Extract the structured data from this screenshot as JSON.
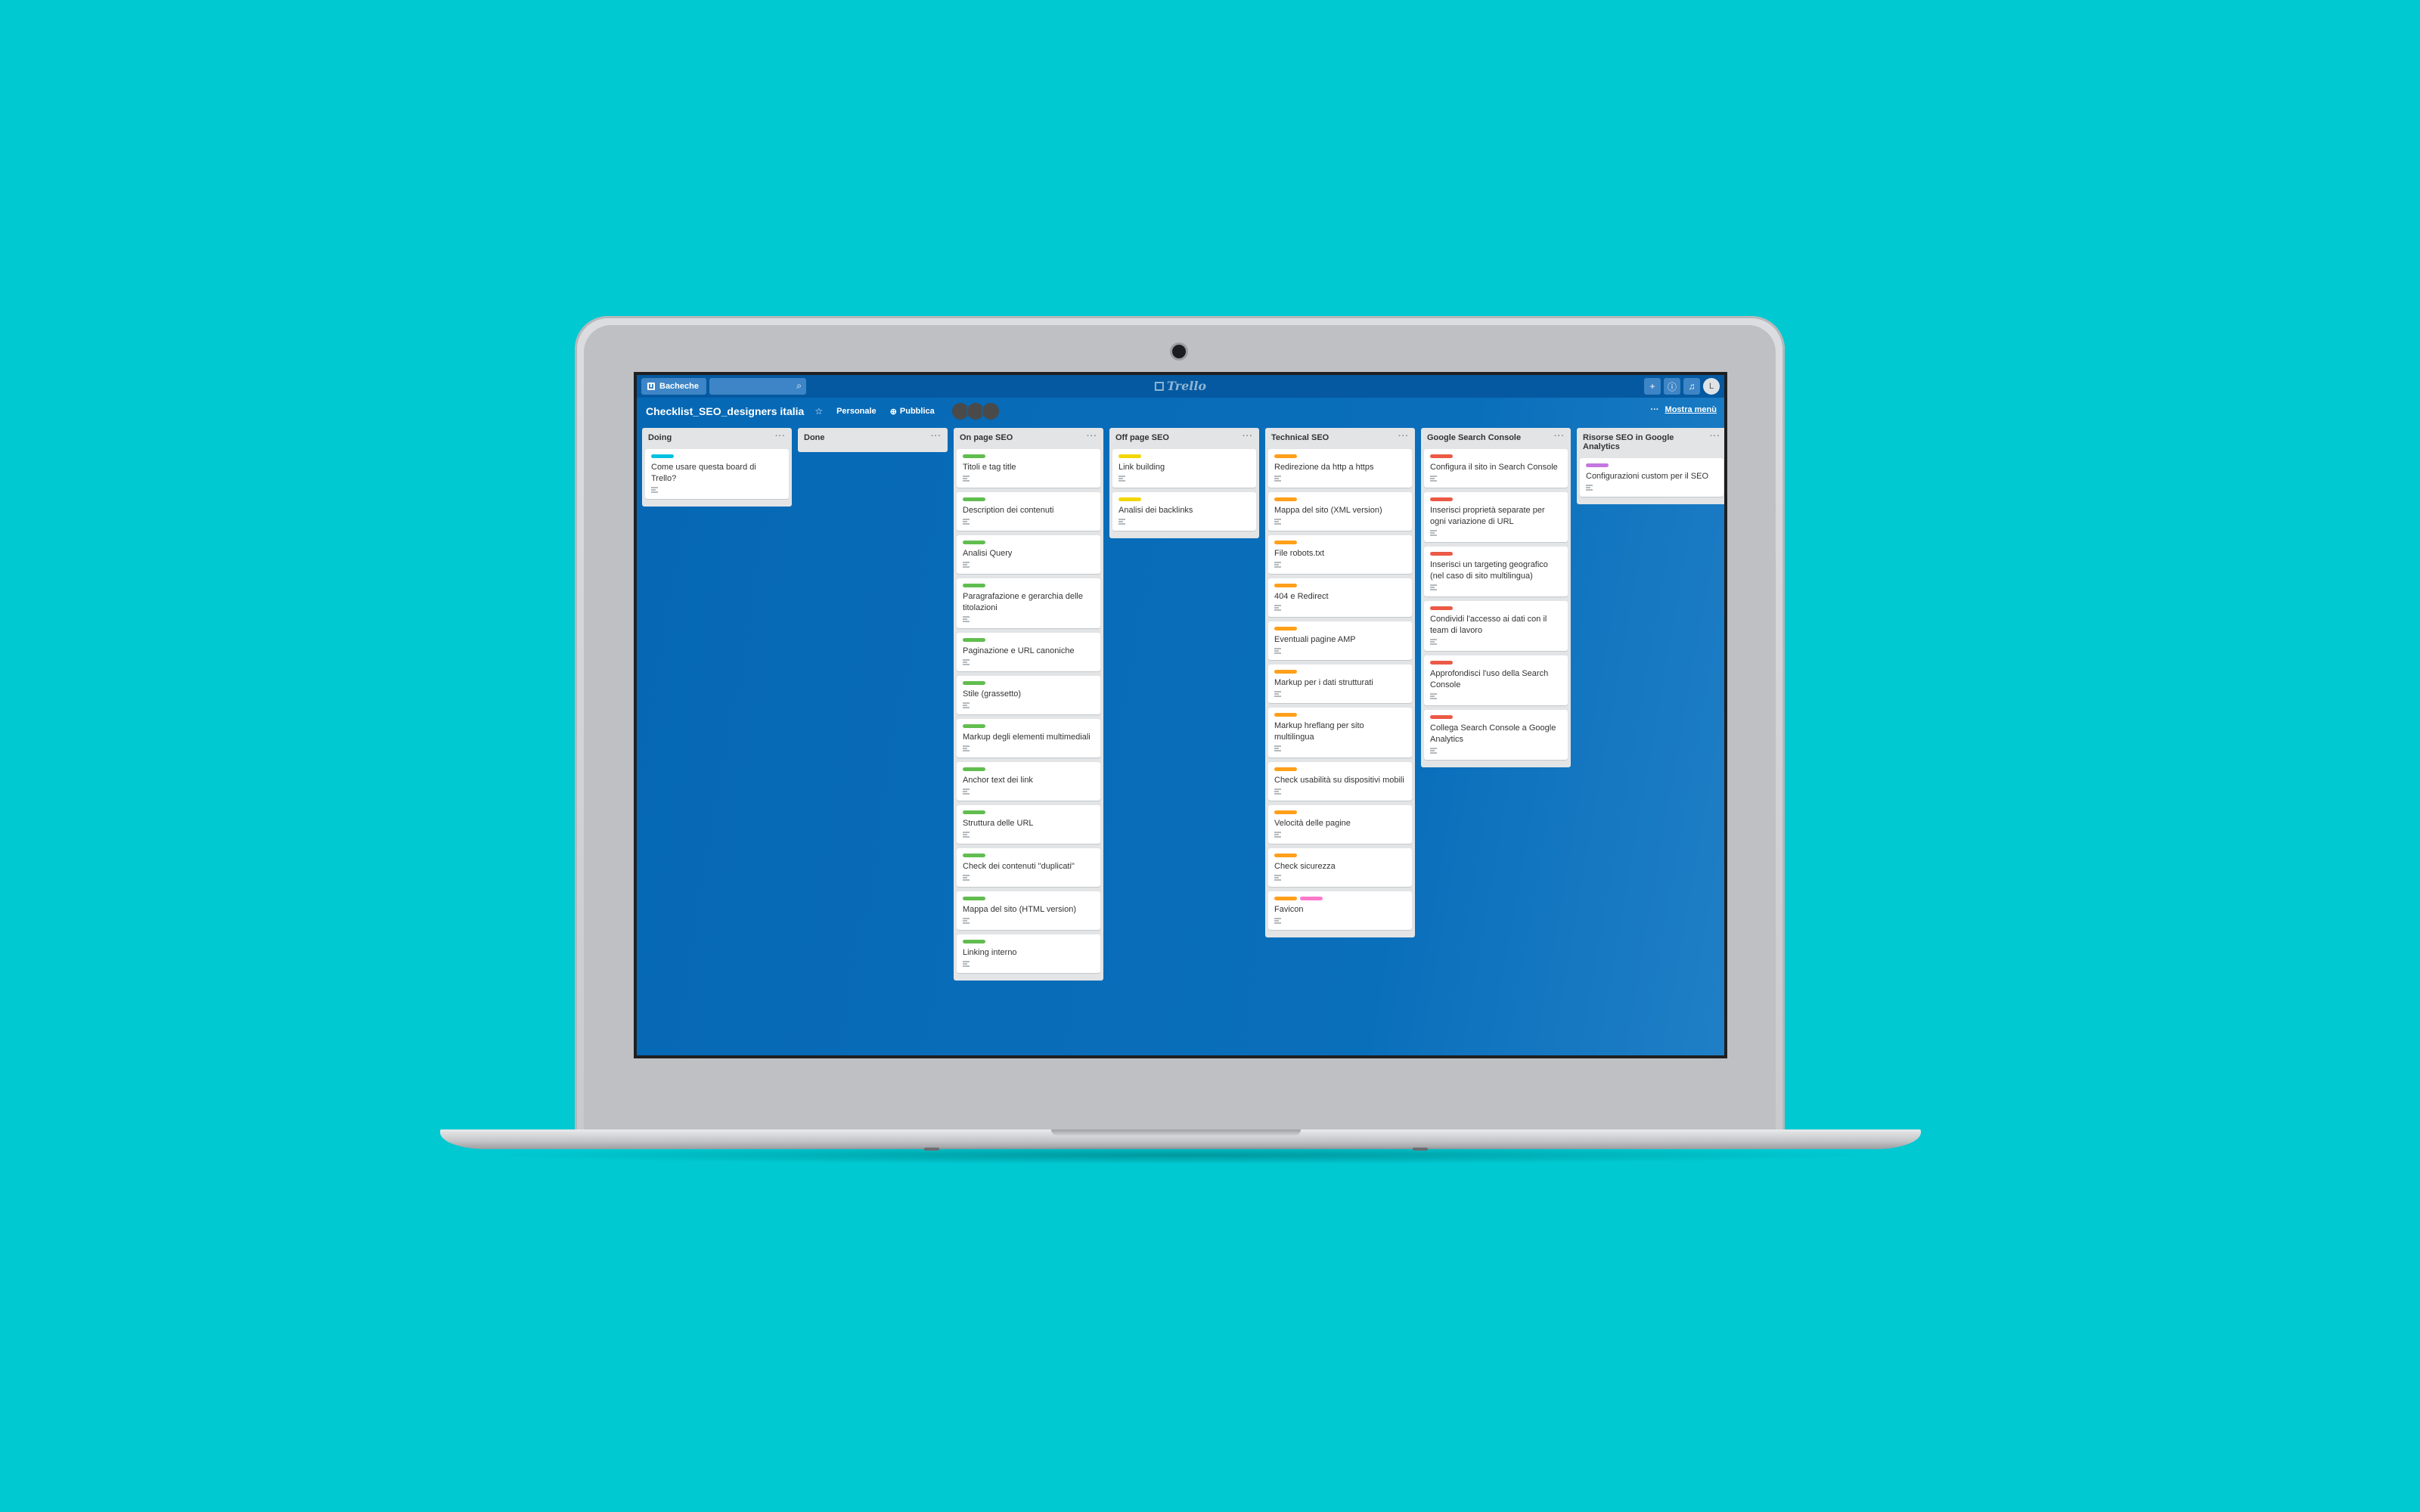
{
  "colors": {
    "background": "#00c9d1",
    "board": "#0668b4",
    "topbar": "#0559a0",
    "label_blue": "#00c2e0",
    "label_green": "#61bd4f",
    "label_yellow": "#f2d600",
    "label_orange": "#ff9f1a",
    "label_red": "#eb5a46",
    "label_purple": "#c377e0",
    "label_pink": "#ff78cb"
  },
  "topbar": {
    "boards_label": "Bacheche",
    "logo": "Trello",
    "search_icon": "search-icon",
    "add_icon": "plus-icon",
    "info_icon": "info-icon",
    "notif_icon": "bell-icon"
  },
  "board": {
    "title": "Checklist_SEO_designers italia",
    "team": "Personale",
    "visibility": "Pubblica",
    "show_menu": "Mostra menù"
  },
  "lists": [
    {
      "name": "Doing",
      "cards": [
        {
          "title": "Come usare questa board di Trello?",
          "labels": [
            "blue"
          ]
        }
      ]
    },
    {
      "name": "Done",
      "cards": []
    },
    {
      "name": "On page SEO",
      "cards": [
        {
          "title": "Titoli e tag title",
          "labels": [
            "green"
          ]
        },
        {
          "title": "Description dei contenuti",
          "labels": [
            "green"
          ]
        },
        {
          "title": "Analisi Query",
          "labels": [
            "green"
          ]
        },
        {
          "title": "Paragrafazione e gerarchia delle titolazioni",
          "labels": [
            "green"
          ]
        },
        {
          "title": "Paginazione e URL canoniche",
          "labels": [
            "green"
          ]
        },
        {
          "title": "Stile (grassetto)",
          "labels": [
            "green"
          ]
        },
        {
          "title": "Markup degli elementi multimediali",
          "labels": [
            "green"
          ]
        },
        {
          "title": "Anchor text dei link",
          "labels": [
            "green"
          ]
        },
        {
          "title": "Struttura delle URL",
          "labels": [
            "green"
          ]
        },
        {
          "title": "Check dei contenuti \"duplicati\"",
          "labels": [
            "green"
          ]
        },
        {
          "title": "Mappa del sito (HTML version)",
          "labels": [
            "green"
          ]
        },
        {
          "title": "Linking interno",
          "labels": [
            "green"
          ]
        }
      ]
    },
    {
      "name": "Off page SEO",
      "cards": [
        {
          "title": "Link building",
          "labels": [
            "yellow"
          ]
        },
        {
          "title": "Analisi dei backlinks",
          "labels": [
            "yellow"
          ]
        }
      ]
    },
    {
      "name": "Technical SEO",
      "cards": [
        {
          "title": "Redirezione da http a https",
          "labels": [
            "orange"
          ]
        },
        {
          "title": "Mappa del sito (XML version)",
          "labels": [
            "orange"
          ]
        },
        {
          "title": "File robots.txt",
          "labels": [
            "orange"
          ]
        },
        {
          "title": "404 e Redirect",
          "labels": [
            "orange"
          ]
        },
        {
          "title": "Eventuali pagine AMP",
          "labels": [
            "orange"
          ]
        },
        {
          "title": "Markup per i dati strutturati",
          "labels": [
            "orange"
          ]
        },
        {
          "title": "Markup hreflang per sito multilingua",
          "labels": [
            "orange"
          ]
        },
        {
          "title": "Check usabilità su dispositivi mobili",
          "labels": [
            "orange"
          ]
        },
        {
          "title": "Velocità delle pagine",
          "labels": [
            "orange"
          ]
        },
        {
          "title": "Check sicurezza",
          "labels": [
            "orange"
          ]
        },
        {
          "title": "Favicon",
          "labels": [
            "orange",
            "pink"
          ]
        }
      ]
    },
    {
      "name": "Google Search Console",
      "cards": [
        {
          "title": "Configura il sito in Search Console",
          "labels": [
            "red"
          ]
        },
        {
          "title": "Inserisci proprietà separate per ogni variazione di URL",
          "labels": [
            "red"
          ]
        },
        {
          "title": "Inserisci un targeting geografico (nel caso di sito multilingua)",
          "labels": [
            "red"
          ]
        },
        {
          "title": "Condividi l'accesso ai dati con il team di lavoro",
          "labels": [
            "red"
          ]
        },
        {
          "title": "Approfondisci l'uso della Search Console",
          "labels": [
            "red"
          ]
        },
        {
          "title": "Collega Search Console a Google Analytics",
          "labels": [
            "red"
          ]
        }
      ]
    },
    {
      "name": "Risorse SEO in Google Analytics",
      "cards": [
        {
          "title": "Configurazioni custom per il SEO",
          "labels": [
            "purple"
          ]
        }
      ]
    }
  ]
}
